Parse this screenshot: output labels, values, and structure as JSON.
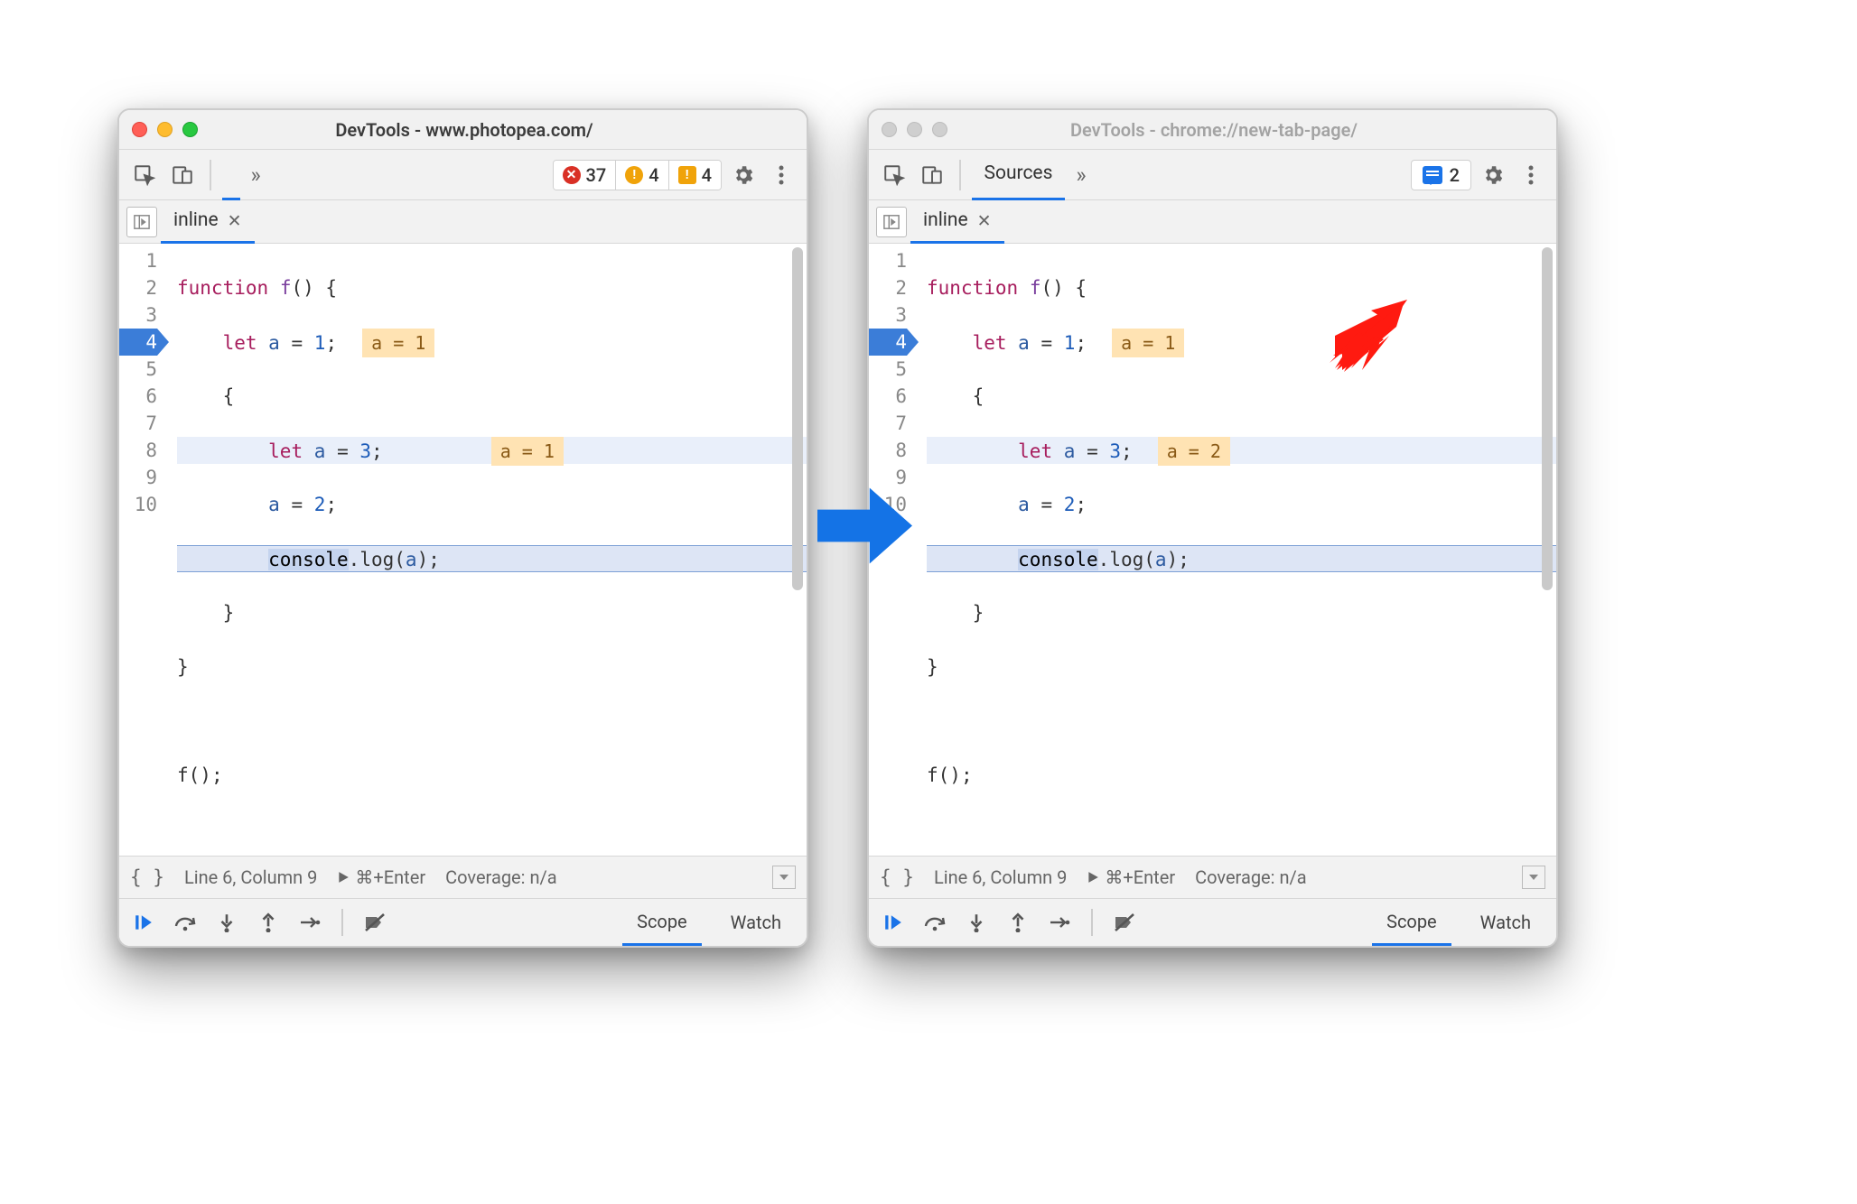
{
  "left": {
    "title": "DevTools - www.photopea.com/",
    "active": true,
    "toolbar": {
      "show_sources_tab": false,
      "badges_kind": "errors",
      "err": "37",
      "warn": "4",
      "issue": "4"
    },
    "file_tab": "inline",
    "hint4": "a = 1",
    "hint2": "a = 1",
    "status": {
      "pos": "Line 6, Column 9",
      "run": "⌘+Enter",
      "cov": "Coverage: n/a"
    },
    "bottom": {
      "scope": "Scope",
      "watch": "Watch"
    }
  },
  "right": {
    "title": "DevTools - chrome://new-tab-page/",
    "active": false,
    "toolbar": {
      "show_sources_tab": true,
      "sources_label": "Sources",
      "badges_kind": "messages",
      "msg": "2"
    },
    "file_tab": "inline",
    "hint4": "a = 2",
    "hint2": "a = 1",
    "status": {
      "pos": "Line 6, Column 9",
      "run": "⌘+Enter",
      "cov": "Coverage: n/a"
    },
    "bottom": {
      "scope": "Scope",
      "watch": "Watch"
    }
  },
  "code": {
    "lineNumbers": [
      "1",
      "2",
      "3",
      "4",
      "5",
      "6",
      "7",
      "8",
      "9",
      "10"
    ]
  }
}
